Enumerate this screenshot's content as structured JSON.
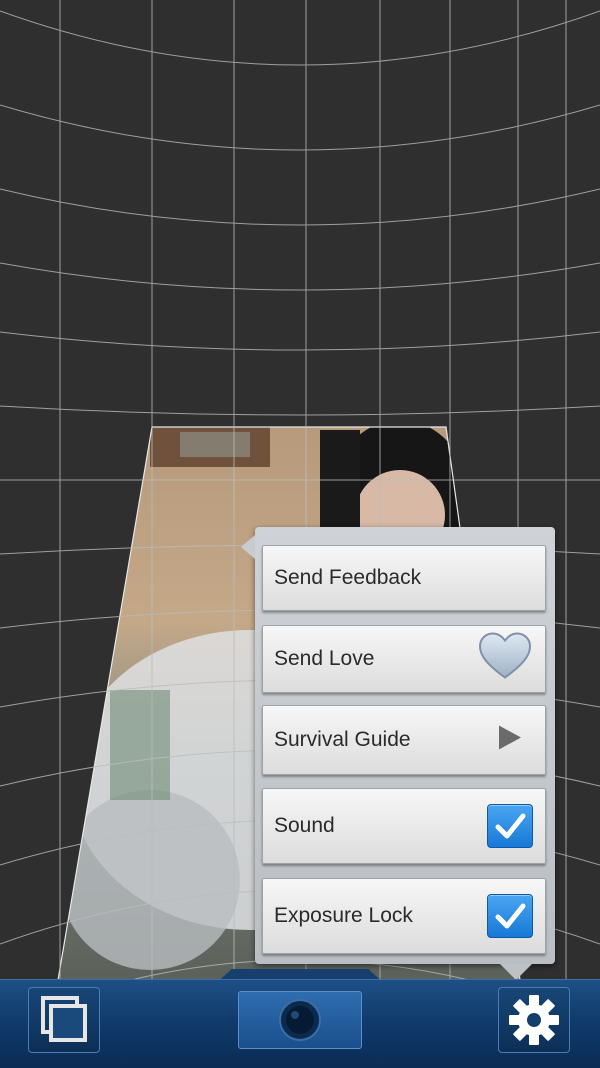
{
  "menu": {
    "items": [
      {
        "label": "Send Feedback",
        "icon": "none"
      },
      {
        "label": "Send Love",
        "icon": "heart-icon"
      },
      {
        "label": "Survival Guide",
        "icon": "play-arrow-icon"
      },
      {
        "label": "Sound",
        "icon": "checkbox-checked-icon",
        "checked": true
      },
      {
        "label": "Exposure Lock",
        "icon": "checkbox-checked-icon",
        "checked": true
      }
    ]
  },
  "toolbar": {
    "gallery_icon": "gallery-icon",
    "shutter_icon": "camera-lens-icon",
    "settings_icon": "gear-icon"
  },
  "colors": {
    "background": "#2f2f2f",
    "grid_line": "#bfbfbf",
    "toolbar": "#0f3a6a",
    "checkbox": "#1778d6"
  }
}
